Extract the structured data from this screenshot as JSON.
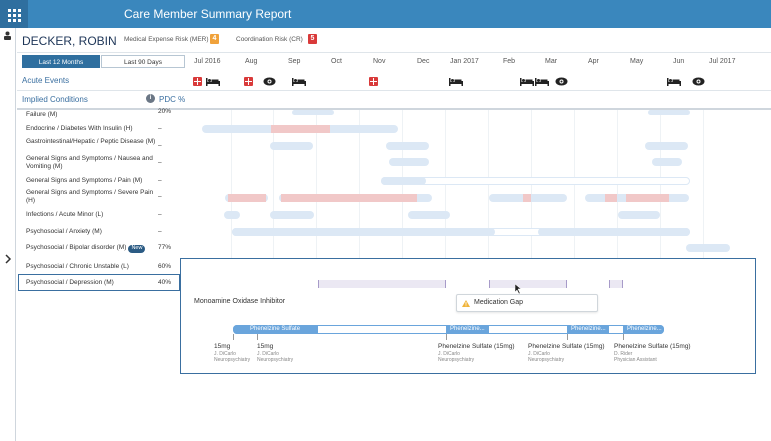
{
  "header": {
    "title": "Care Member Summary Report"
  },
  "patient": {
    "name": "DECKER, ROBIN",
    "mer_label": "Medical Expense Risk (MER)",
    "mer_value": "4",
    "mer_color": "#f0a23b",
    "cr_label": "Coordination Risk (CR)",
    "cr_value": "5",
    "cr_color": "#d93a3a"
  },
  "range": {
    "active": "Last 12 Months",
    "inactive": "Last 90 Days"
  },
  "months": [
    "Jul 2016",
    "Aug",
    "Sep",
    "Oct",
    "Nov",
    "Dec",
    "Jan 2017",
    "Feb",
    "Mar",
    "Apr",
    "May",
    "Jun",
    "Jul 2017"
  ],
  "sections": {
    "acute": "Acute Events",
    "implied": "Implied Conditions",
    "info_icon": "i",
    "pdc": "PDC %"
  },
  "conditions": [
    {
      "label": "Failure (M)",
      "pdc": "20%"
    },
    {
      "label": "Endocrine / Diabetes With Insulin (H)",
      "pdc": "–"
    },
    {
      "label": "Gastrointestinal/Hepatic / Peptic Disease (M)",
      "pdc": "–"
    },
    {
      "label": "General Signs and Symptoms / Nausea and Vomiting (M)",
      "pdc": "–"
    },
    {
      "label": "General Signs and Symptoms / Pain (M)",
      "pdc": "–"
    },
    {
      "label": "General Signs and Symptoms / Severe Pain (H)",
      "pdc": "–"
    },
    {
      "label": "Infections / Acute Minor (L)",
      "pdc": "–"
    },
    {
      "label": "Psychosocial / Anxiety (M)",
      "pdc": "–"
    },
    {
      "label": "Psychosocial / Bipolar disorder (M)",
      "pdc": "77%",
      "badge": "New"
    },
    {
      "label": "Psychosocial / Chronic Unstable (L)",
      "pdc": "60%"
    },
    {
      "label": "Psychosocial / Depression (M)",
      "pdc": "40%"
    }
  ],
  "detail": {
    "drug_class": "Monoamine Oxidase Inhibitor",
    "tooltip": "Medication Gap",
    "segments": [
      "Phenelzine Sulfate",
      "Phenelzine...",
      "Phenelzine...",
      "Phenelzine..."
    ],
    "doses": [
      {
        "dose": "15mg",
        "prescriber": "J. DiCarlo",
        "specialty": "Neuropsychiatry"
      },
      {
        "dose": "15mg",
        "prescriber": "J. DiCarlo",
        "specialty": "Neuropsychiatry"
      },
      {
        "dose": "Phenelzine Sulfate (15mg)",
        "prescriber": "J. DiCarlo",
        "specialty": "Neuropsychiatry"
      },
      {
        "dose": "Phenelzine Sulfate (15mg)",
        "prescriber": "J. DiCarlo",
        "specialty": "Neuropsychiatry"
      },
      {
        "dose": "Phenelzine Sulfate (15mg)",
        "prescriber": "D. Rider",
        "specialty": "Physician Assistant"
      }
    ]
  }
}
